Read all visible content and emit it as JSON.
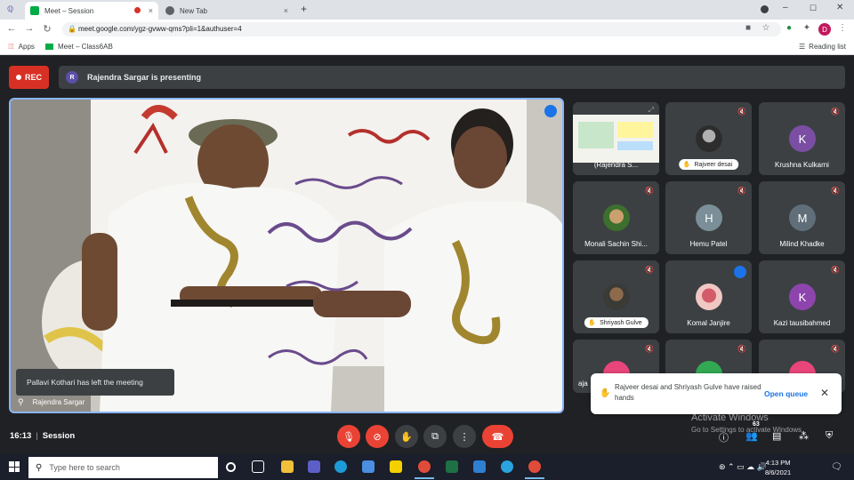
{
  "browser": {
    "tabs": [
      {
        "label": "Meet – Session",
        "close": "×"
      },
      {
        "label": "New Tab",
        "close": "×"
      }
    ],
    "new_tab": "+",
    "url": "meet.google.com/ygz-gvww-qms?pli=1&authuser=4",
    "profile_initial": "D",
    "bookmarks": {
      "apps": "Apps",
      "meet": "Meet – Class6AB",
      "reading_list": "Reading list"
    }
  },
  "meet": {
    "rec_label": "REC",
    "presenter_initial": "R",
    "presenting_text": "Rajendra Sargar is presenting",
    "toast": "Pallavi Kothari has left the meeting",
    "main_name": "Rajendra Sargar",
    "tiles": [
      {
        "name": "(Rajendra S...",
        "type": "screen"
      },
      {
        "name": "Rajveer desai",
        "type": "hand-raised"
      },
      {
        "name": "Krushna Kulkarni",
        "initial": "K",
        "color": "#7b4ea3"
      },
      {
        "name": "Monali Sachin Shi...",
        "type": "photo"
      },
      {
        "name": "Hemu Patel",
        "initial": "H",
        "color": "#7a8f98"
      },
      {
        "name": "Milind Khadke",
        "initial": "M",
        "color": "#5f6e78"
      },
      {
        "name": "Shriyash Gulve",
        "type": "hand-raised"
      },
      {
        "name": "Komal Janjire",
        "type": "photo"
      },
      {
        "name": "Kazi tausibahmed",
        "initial": "K",
        "color": "#8e44ad"
      },
      {
        "name": "aja"
      }
    ],
    "raised_hands": {
      "text": "Rajveer desai and Shriyash Gulve have raised hands",
      "action": "Open queue",
      "close": "✕"
    },
    "watermark": {
      "title": "Activate Windows",
      "sub": "Go to Settings to activate Windows."
    },
    "time": "16:13",
    "meeting_name": "Session",
    "people_count": "63"
  },
  "taskbar": {
    "search_placeholder": "Type here to search",
    "time": "4:13 PM",
    "date": "8/6/2021"
  },
  "colors": {
    "accent": "#1a73e8",
    "danger": "#ea4335",
    "meet_bg": "#202124",
    "tile_bg": "#3c4043"
  }
}
